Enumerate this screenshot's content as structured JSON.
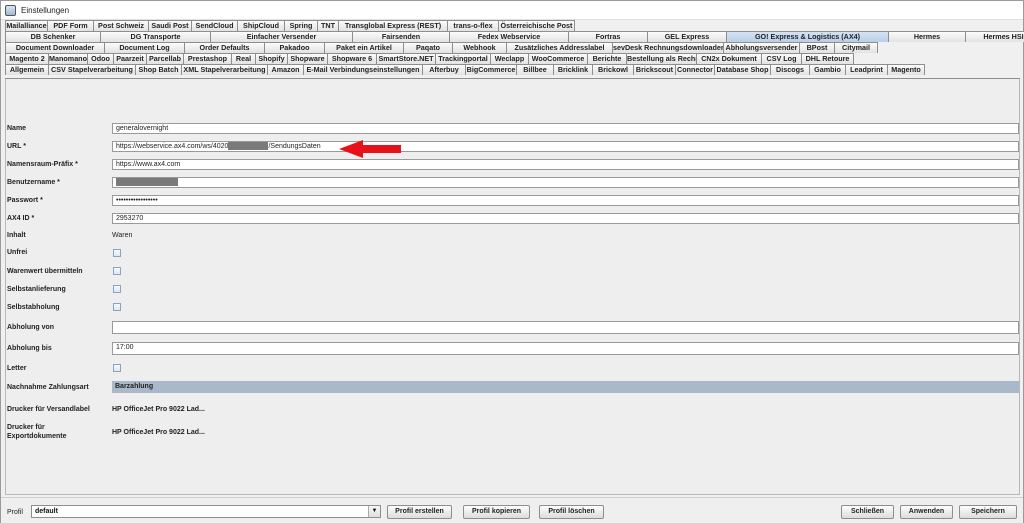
{
  "window": {
    "title": "Einstellungen"
  },
  "tab_rows": [
    [
      "Mailalliance",
      "PDF Form",
      "Post Schweiz",
      "Saudi Post",
      "SendCloud",
      "ShipCloud",
      "Spring",
      "TNT",
      "Transglobal Express (REST)",
      "trans-o-flex",
      "Österreichische Post"
    ],
    [
      "DB Schenker",
      "DG Transporte",
      "Einfacher Versender",
      "Fairsenden",
      "Fedex Webservice",
      "Fortras",
      "GEL Express",
      "GO! Express & Logistics (AX4)",
      "Hermes",
      "Hermes HSI"
    ],
    [
      "Document Downloader",
      "Document Log",
      "Order Defaults",
      "Pakadoo",
      "Paket ein Artikel",
      "Paqato",
      "Webhook",
      "Zusätzliches Addresslabel",
      "sevDesk Rechnungsdownloader",
      "Abholungsversender",
      "BPost",
      "Citymail"
    ],
    [
      "Magento 2",
      "Manomano",
      "Odoo",
      "Paarzeit",
      "Parcellab",
      "Prestashop",
      "Real",
      "Shopify",
      "Shopware",
      "Shopware 6",
      "SmartStore.NET",
      "Trackingportal",
      "Weclapp",
      "WooCommerce",
      "Berichte",
      "Bestellung als Rechnung",
      "CN2x Dokument",
      "CSV Log",
      "DHL Retoure"
    ],
    [
      "Allgemein",
      "CSV Stapelverarbeitung",
      "Shop Batch",
      "XML Stapelverarbeitung",
      "Amazon",
      "E-Mail Verbindungseinstellungen",
      "Afterbuy",
      "BigCommerce",
      "Billbee",
      "Bricklink",
      "Brickowl",
      "Brickscout",
      "Connector",
      "Database Shop",
      "Discogs",
      "Gambio",
      "Leadprint",
      "Magento"
    ]
  ],
  "active_tab": "GO! Express & Logistics (AX4)",
  "form": {
    "name_label": "Name",
    "name_value": "generalovernight",
    "url_label": "URL *",
    "url_prefix": "https://webservice.ax4.com/ws/4020",
    "url_suffix": "/SendungsDaten",
    "ns_label": "Namensraum-Präfix *",
    "ns_value": "https://www.ax4.com",
    "user_label": "Benutzername *",
    "password_label": "Passwort *",
    "password_value": "•••••••••••••••••",
    "ax4id_label": "AX4 ID *",
    "ax4id_value": "2953270",
    "inhalt_label": "Inhalt",
    "inhalt_value": "Waren",
    "unfrei_label": "Unfrei",
    "warenwert_label": "Warenwert übermitteln",
    "selbstanlieferung_label": "Selbstanlieferung",
    "selbstabholung_label": "Selbstabholung",
    "abholung_von_label": "Abholung von",
    "abholung_von_value": "",
    "abholung_bis_label": "Abholung bis",
    "abholung_bis_value": "17:00",
    "letter_label": "Letter",
    "nachnahme_label": "Nachnahme Zahlungsart",
    "nachnahme_value": "Barzahlung",
    "drucker_label": "Drucker für Versandlabel",
    "drucker_value": "HP OfficeJet Pro 9022 Lad...",
    "drucker_export_label_1": "Drucker für",
    "drucker_export_label_2": "Exportdokumente",
    "drucker_export_value": "HP OfficeJet Pro 9022 Lad..."
  },
  "footer": {
    "profil_label": "Profil",
    "profil_value": "default",
    "btn_create": "Profil erstellen",
    "btn_copy": "Profil kopieren",
    "btn_delete": "Profil löschen",
    "btn_close": "Schließen",
    "btn_apply": "Anwenden",
    "btn_save": "Speichern"
  },
  "colors": {
    "annotation_arrow": "#e8101a",
    "active_tab": "#c6d9ec",
    "selection": "#a9b9c9"
  }
}
